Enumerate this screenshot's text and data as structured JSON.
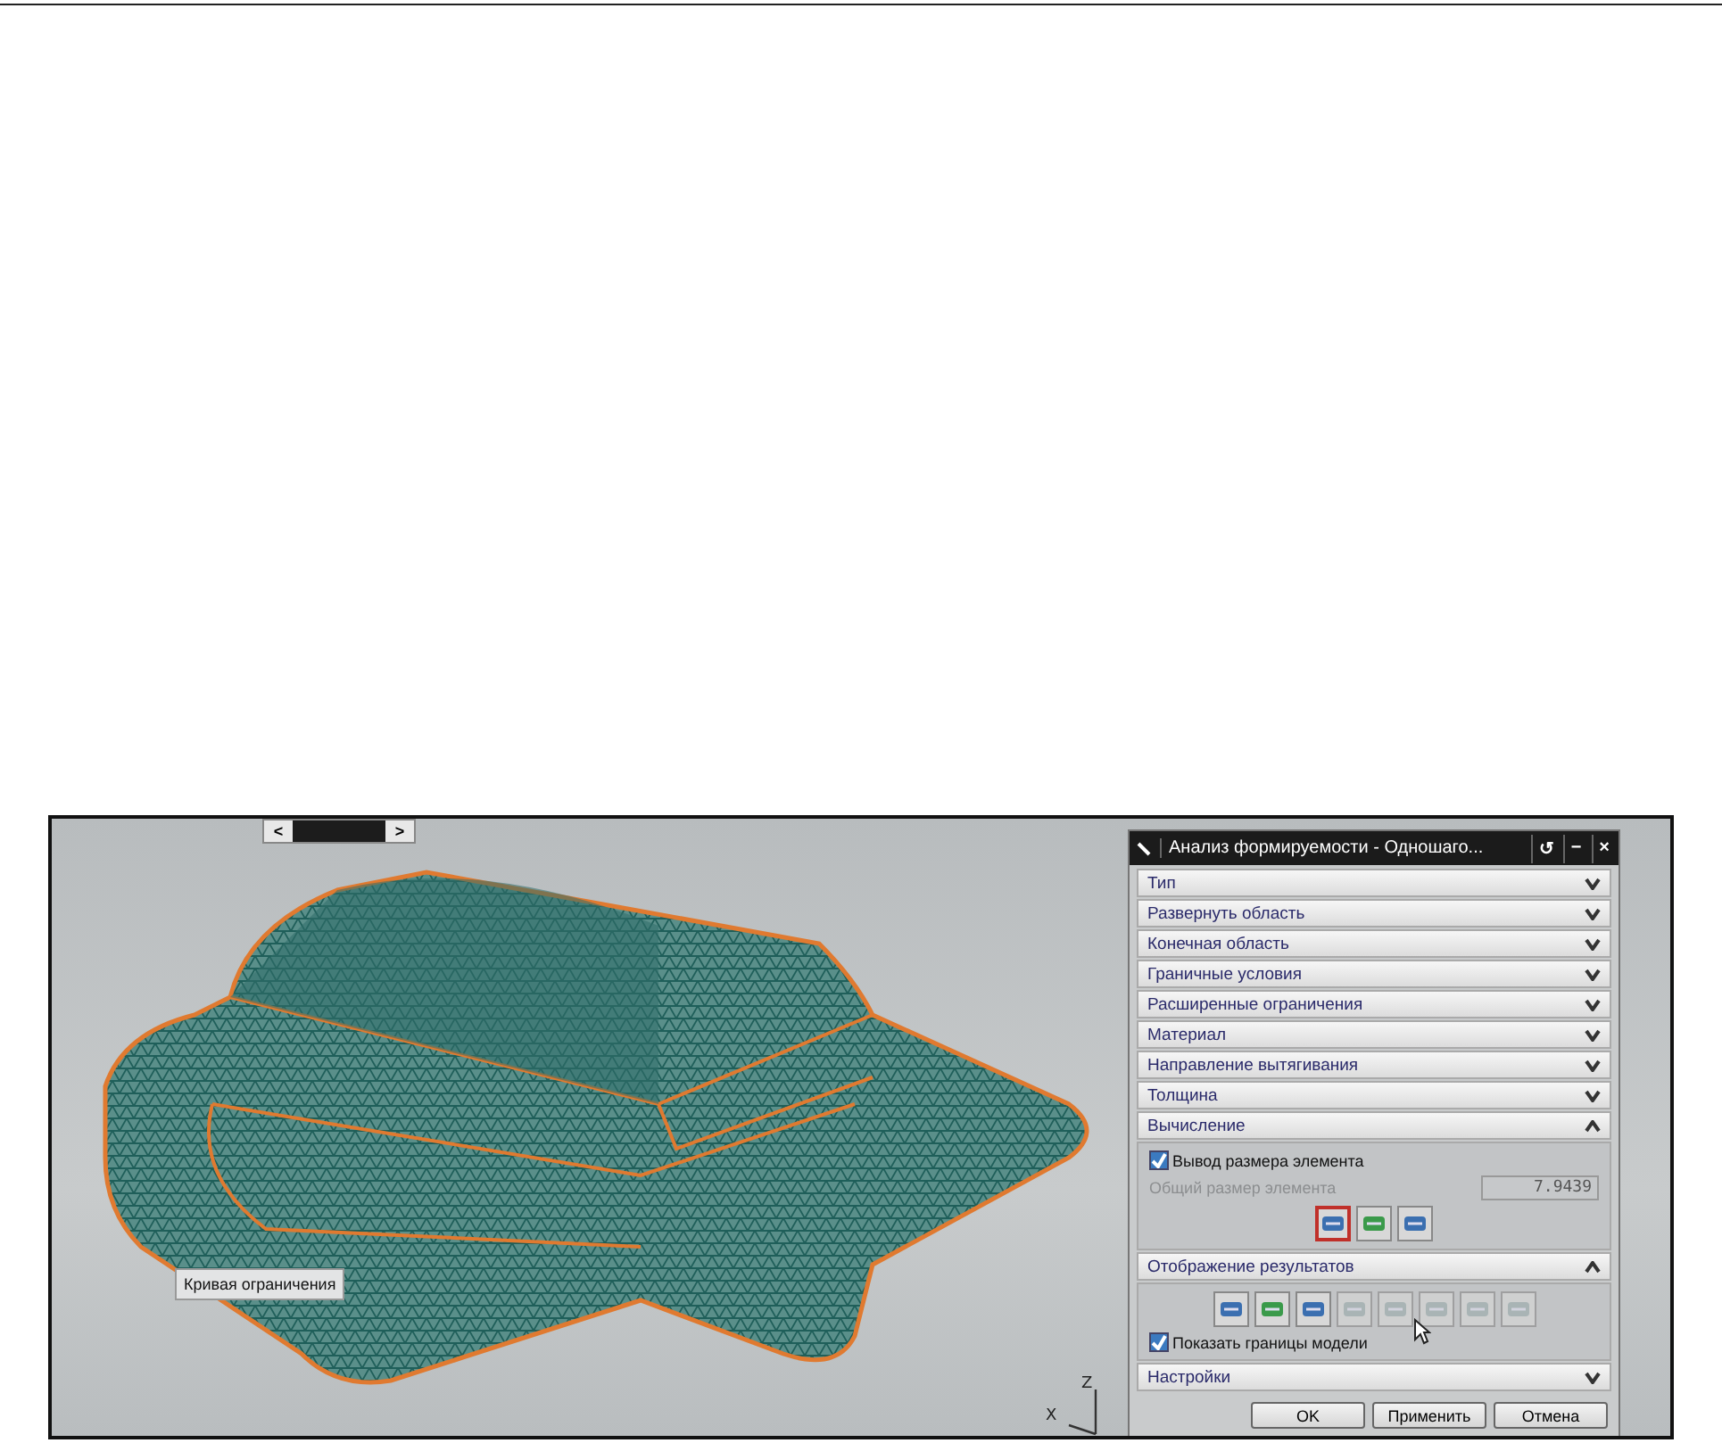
{
  "viewport": {
    "scrollbar": {
      "left": "<",
      "right": ">"
    },
    "tooltip": "Кривая ограничения",
    "axes": [
      "Z",
      "X"
    ]
  },
  "dialog": {
    "title": "Анализ формируемости - Одношаго...",
    "title_buttons": [
      "↺",
      "−",
      "×"
    ],
    "sections": [
      {
        "title": "Тип",
        "expanded": false
      },
      {
        "title": "Развернуть область",
        "expanded": false
      },
      {
        "title": "Конечная область",
        "expanded": false
      },
      {
        "title": "Граничные условия",
        "expanded": false
      },
      {
        "title": "Расширенные ограничения",
        "expanded": false
      },
      {
        "title": "Материал",
        "expanded": false
      },
      {
        "title": "Направление вытягивания",
        "expanded": false
      },
      {
        "title": "Толщина",
        "expanded": false
      },
      {
        "title": "Вычисление",
        "expanded": true,
        "checkbox": {
          "label": "Вывод размера элемента",
          "checked": true
        },
        "field": {
          "label": "Общий размер элемента",
          "value": "7.9439",
          "disabled": true
        },
        "tools": [
          {
            "selected": true,
            "disabled": false
          },
          {
            "selected": false,
            "disabled": false
          },
          {
            "selected": false,
            "disabled": false
          }
        ]
      },
      {
        "title": "Отображение результатов",
        "expanded": true,
        "tools": [
          {
            "selected": false,
            "disabled": false
          },
          {
            "selected": false,
            "disabled": false
          },
          {
            "selected": false,
            "disabled": false
          },
          {
            "selected": false,
            "disabled": true
          },
          {
            "selected": false,
            "disabled": true
          },
          {
            "selected": false,
            "disabled": true
          },
          {
            "selected": false,
            "disabled": true
          },
          {
            "selected": false,
            "disabled": true
          }
        ],
        "checkbox": {
          "label": "Показать границы модели",
          "checked": true
        }
      },
      {
        "title": "Настройки",
        "expanded": false
      }
    ],
    "buttons": [
      "OK",
      "Применить",
      "Отмена"
    ]
  }
}
